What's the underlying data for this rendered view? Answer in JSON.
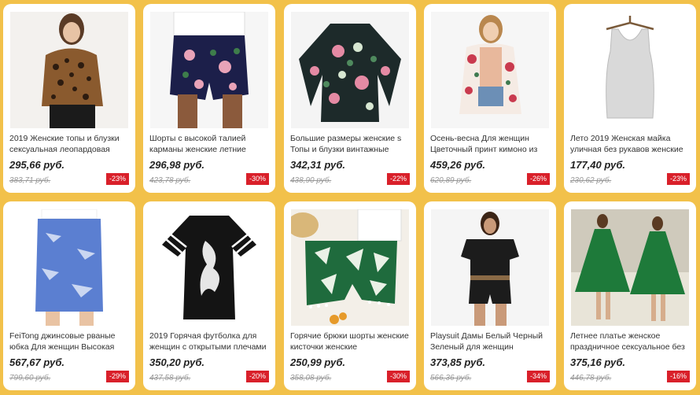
{
  "products": [
    {
      "title": "2019 Женские топы и блузки сексуальная леопардовая",
      "price": "295,66 руб.",
      "old_price": "383,71 руб.",
      "discount": "-23%"
    },
    {
      "title": "Шорты с высокой талией карманы женские летние",
      "price": "296,98 руб.",
      "old_price": "423,78 руб.",
      "discount": "-30%"
    },
    {
      "title": "Большие размеры женские s Топы и блузки винтажные",
      "price": "342,31 руб.",
      "old_price": "438,90 руб.",
      "discount": "-22%"
    },
    {
      "title": "Осень-весна Для женщин Цветочный принт кимоно из",
      "price": "459,26 руб.",
      "old_price": "620,89 руб.",
      "discount": "-26%"
    },
    {
      "title": "Лето 2019 Женская майка уличная без рукавов женские",
      "price": "177,40 руб.",
      "old_price": "230,62 руб.",
      "discount": "-23%"
    },
    {
      "title": "FeiTong джинсовые рваные юбка Для женщин Высокая",
      "price": "567,67 руб.",
      "old_price": "799,60 руб.",
      "discount": "-29%"
    },
    {
      "title": "2019 Горячая футболка для женщин с открытыми плечами",
      "price": "350,20 руб.",
      "old_price": "437,58 руб.",
      "discount": "-20%"
    },
    {
      "title": "Горячие брюки шорты женские кисточки женские",
      "price": "250,99 руб.",
      "old_price": "358,08 руб.",
      "discount": "-30%"
    },
    {
      "title": "Playsuit Дамы Белый Черный Зеленый для женщин",
      "price": "373,85 руб.",
      "old_price": "566,36 руб.",
      "discount": "-34%"
    },
    {
      "title": "Летнее платье женское праздничное сексуальное без",
      "price": "375,16 руб.",
      "old_price": "446,78 руб.",
      "discount": "-16%"
    }
  ]
}
